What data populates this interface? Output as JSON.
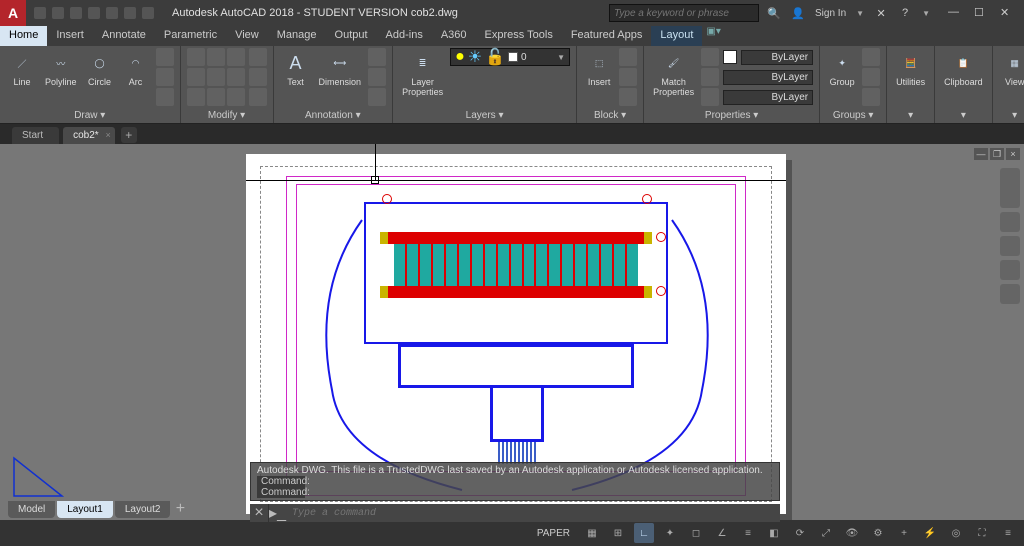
{
  "title": "Autodesk AutoCAD 2018 - STUDENT VERSION   cob2.dwg",
  "search_placeholder": "Type a keyword or phrase",
  "sign_in": "Sign In",
  "ribbon_tabs": [
    "Home",
    "Insert",
    "Annotate",
    "Parametric",
    "View",
    "Manage",
    "Output",
    "Add-ins",
    "A360",
    "Express Tools",
    "Featured Apps",
    "Layout"
  ],
  "active_tab": "Home",
  "panels": {
    "draw": {
      "title": "Draw ▾",
      "items": [
        "Line",
        "Polyline",
        "Circle",
        "Arc"
      ]
    },
    "modify": {
      "title": "Modify ▾"
    },
    "annotation": {
      "title": "Annotation ▾",
      "items": [
        "Text",
        "Dimension"
      ]
    },
    "layers": {
      "title": "Layers ▾",
      "big": "Layer\nProperties",
      "current": "0"
    },
    "block": {
      "title": "Block ▾",
      "big": "Insert"
    },
    "properties": {
      "title": "Properties ▾",
      "big": "Match\nProperties",
      "rows": [
        "ByLayer",
        "ByLayer",
        "ByLayer"
      ]
    },
    "groups": {
      "title": "Groups ▾",
      "big": "Group"
    },
    "utilities": {
      "title": "Utilities"
    },
    "clipboard": {
      "title": "Clipboard"
    },
    "view": {
      "title": "View"
    }
  },
  "doc_tabs": {
    "start": "Start",
    "file": "cob2*"
  },
  "command": {
    "msg": "Autodesk DWG.  This file is a TrustedDWG last saved by an Autodesk application or Autodesk licensed application.",
    "label": "Command:",
    "placeholder": "Type a command"
  },
  "layout_tabs": [
    "Model",
    "Layout1",
    "Layout2"
  ],
  "active_layout": "Layout1",
  "status": {
    "space": "PAPER"
  }
}
